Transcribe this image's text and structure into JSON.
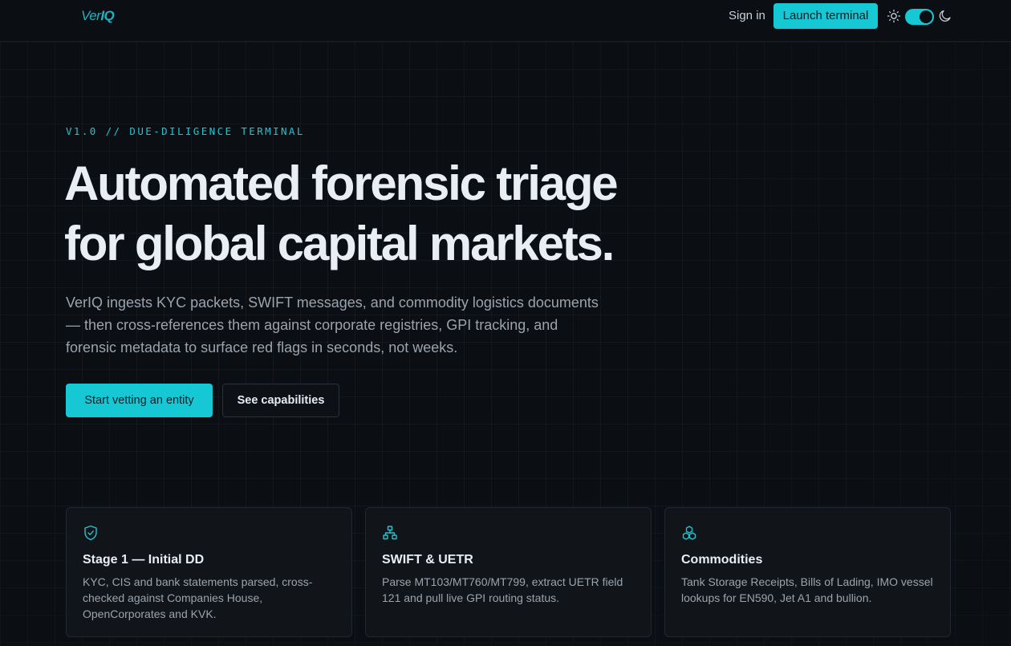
{
  "nav": {
    "logo": {
      "prefix": "Ver",
      "suffix": "IQ"
    },
    "sign_in": "Sign in",
    "launch": "Launch terminal",
    "theme_icons": [
      "sun-icon",
      "moon-icon"
    ]
  },
  "hero": {
    "eyebrow": "V1.0 // DUE-DILIGENCE TERMINAL",
    "headline_line1": "Automated forensic triage",
    "headline_line2": "for global capital markets.",
    "lead": "VerIQ ingests KYC packets, SWIFT messages, and commodity logistics documents — then cross-references them against corporate registries, GPI tracking, and forensic metadata to surface red flags in seconds, not weeks.",
    "primary_cta": "Start vetting an entity",
    "secondary_cta": "See capabilities"
  },
  "cards": [
    {
      "icon": "shield-check-icon",
      "title": "Stage 1 — Initial DD",
      "body": "KYC, CIS and bank statements parsed, cross-checked against Companies House, OpenCorporates and KVK."
    },
    {
      "icon": "network-icon",
      "title": "SWIFT & UETR",
      "body": "Parse MT103/MT760/MT799, extract UETR field 121 and pull live GPI routing status."
    },
    {
      "icon": "boxes-icon",
      "title": "Commodities",
      "body": "Tank Storage Receipts, Bills of Lading, IMO vessel lookups for EN590, Jet A1 and bullion."
    }
  ],
  "colors": {
    "accent": "#16c8d4",
    "background": "#0b0e13",
    "card_bg": "#111419",
    "muted_text": "#9aa4ae"
  }
}
